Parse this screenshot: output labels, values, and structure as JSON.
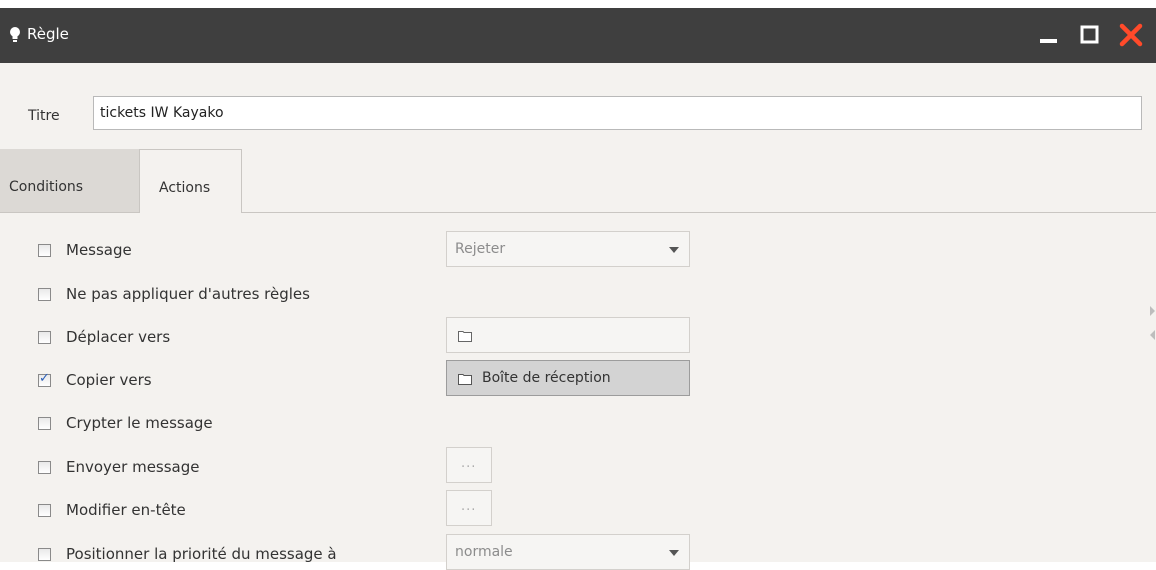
{
  "window": {
    "title": "Règle",
    "title_icon": "lightbulb-icon",
    "buttons": [
      "minimize-icon",
      "maximize-icon",
      "close-icon"
    ]
  },
  "form": {
    "title_label": "Titre",
    "title_value": "tickets IW Kayako"
  },
  "tabs": [
    {
      "label": "Conditions",
      "active": false
    },
    {
      "label": "Actions",
      "active": true
    }
  ],
  "actions": [
    {
      "label": "Message",
      "checked": false,
      "control": "select",
      "value": "Rejeter"
    },
    {
      "label": "Ne pas appliquer d'autres règles",
      "checked": false,
      "control": "none"
    },
    {
      "label": "Déplacer vers",
      "checked": false,
      "control": "folder",
      "value": ""
    },
    {
      "label": "Copier vers",
      "checked": true,
      "control": "folder",
      "value": "Boîte de réception"
    },
    {
      "label": "Crypter le message",
      "checked": false,
      "control": "none"
    },
    {
      "label": "Envoyer message",
      "checked": false,
      "control": "dots",
      "value": "..."
    },
    {
      "label": "Modifier en-tête",
      "checked": false,
      "control": "dots",
      "value": "..."
    },
    {
      "label": "Positionner la priorité du message à",
      "checked": false,
      "control": "select",
      "value": "normale"
    }
  ],
  "colors": {
    "titlebar": "#3f3f3f",
    "close": "#ff4a2a",
    "check": "#2c5fb8"
  }
}
